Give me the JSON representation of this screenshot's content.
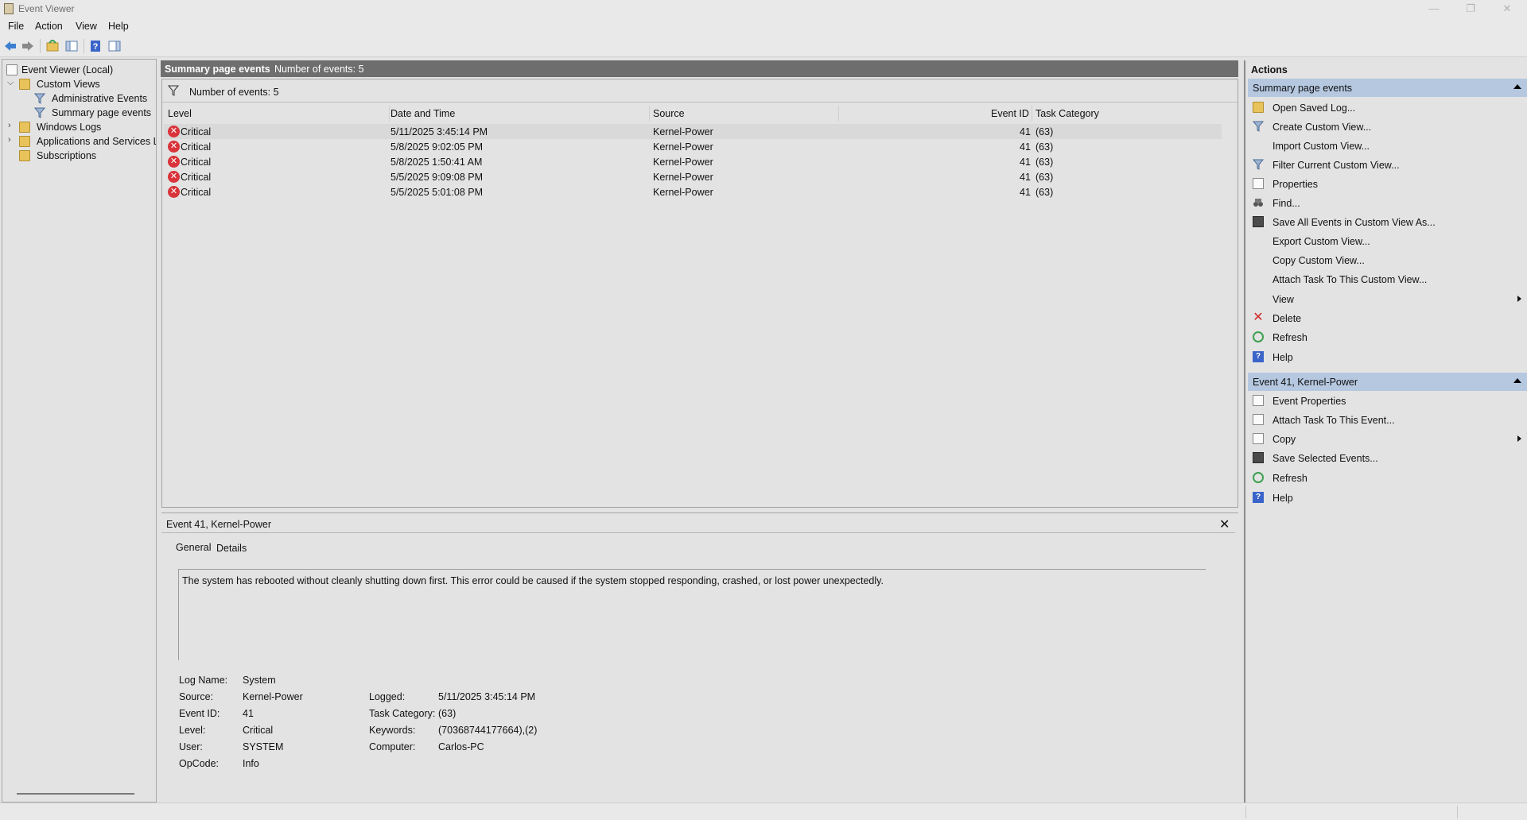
{
  "window": {
    "title": "Event Viewer",
    "minimize": "—",
    "restore": "❐",
    "close": "✕"
  },
  "menu": [
    "File",
    "Action",
    "View",
    "Help"
  ],
  "tree": {
    "root": "Event Viewer (Local)",
    "custom_views": "Custom Views",
    "admin_events": "Administrative Events",
    "summary_events": "Summary page events",
    "windows_logs": "Windows Logs",
    "apps_services": "Applications and Services Lo",
    "subscriptions": "Subscriptions"
  },
  "center": {
    "header_title": "Summary page events",
    "header_count": "Number of events: 5",
    "filter_label": "Number of events: 5",
    "columns": [
      "Level",
      "Date and Time",
      "Source",
      "Event ID",
      "Task Category"
    ],
    "rows": [
      {
        "level": "Critical",
        "datetime": "5/11/2025 3:45:14 PM",
        "source": "Kernel-Power",
        "event_id": "41",
        "task": "(63)"
      },
      {
        "level": "Critical",
        "datetime": "5/8/2025 9:02:05 PM",
        "source": "Kernel-Power",
        "event_id": "41",
        "task": "(63)"
      },
      {
        "level": "Critical",
        "datetime": "5/8/2025 1:50:41 AM",
        "source": "Kernel-Power",
        "event_id": "41",
        "task": "(63)"
      },
      {
        "level": "Critical",
        "datetime": "5/5/2025 9:09:08 PM",
        "source": "Kernel-Power",
        "event_id": "41",
        "task": "(63)"
      },
      {
        "level": "Critical",
        "datetime": "5/5/2025 5:01:08 PM",
        "source": "Kernel-Power",
        "event_id": "41",
        "task": "(63)"
      }
    ]
  },
  "details": {
    "title": "Event 41, Kernel-Power",
    "close": "✕",
    "tabs": [
      "General",
      "Details"
    ],
    "description": "The system has rebooted without cleanly shutting down first. This error could be caused if the system stopped responding, crashed, or lost power unexpectedly.",
    "log_name_label": "Log Name:",
    "log_name": "System",
    "source_label": "Source:",
    "source": "Kernel-Power",
    "event_id_label": "Event ID:",
    "event_id": "41",
    "level_label": "Level:",
    "level": "Critical",
    "user_label": "User:",
    "user": "SYSTEM",
    "opcode_label": "OpCode:",
    "opcode": "Info",
    "logged_label": "Logged:",
    "logged": "5/11/2025 3:45:14 PM",
    "task_label": "Task Category:",
    "task": "(63)",
    "keywords_label": "Keywords:",
    "keywords": "(70368744177664),(2)",
    "computer_label": "Computer:",
    "computer": "Carlos-PC"
  },
  "actions": {
    "header": "Actions",
    "section1": "Summary page events",
    "items1": [
      "Open Saved Log...",
      "Create Custom View...",
      "Import Custom View...",
      "Filter Current Custom View...",
      "Properties",
      "Find...",
      "Save All Events in Custom View As...",
      "Export Custom View...",
      "Copy Custom View...",
      "Attach Task To This Custom View...",
      "View",
      "Delete",
      "Refresh",
      "Help"
    ],
    "section2": "Event 41, Kernel-Power",
    "items2": [
      "Event Properties",
      "Attach Task To This Event...",
      "Copy",
      "Save Selected Events...",
      "Refresh",
      "Help"
    ]
  },
  "colors": {
    "header_bg": "#6e6e6e",
    "section_bg": "#b5c8e0",
    "critical": "#d8343a"
  }
}
